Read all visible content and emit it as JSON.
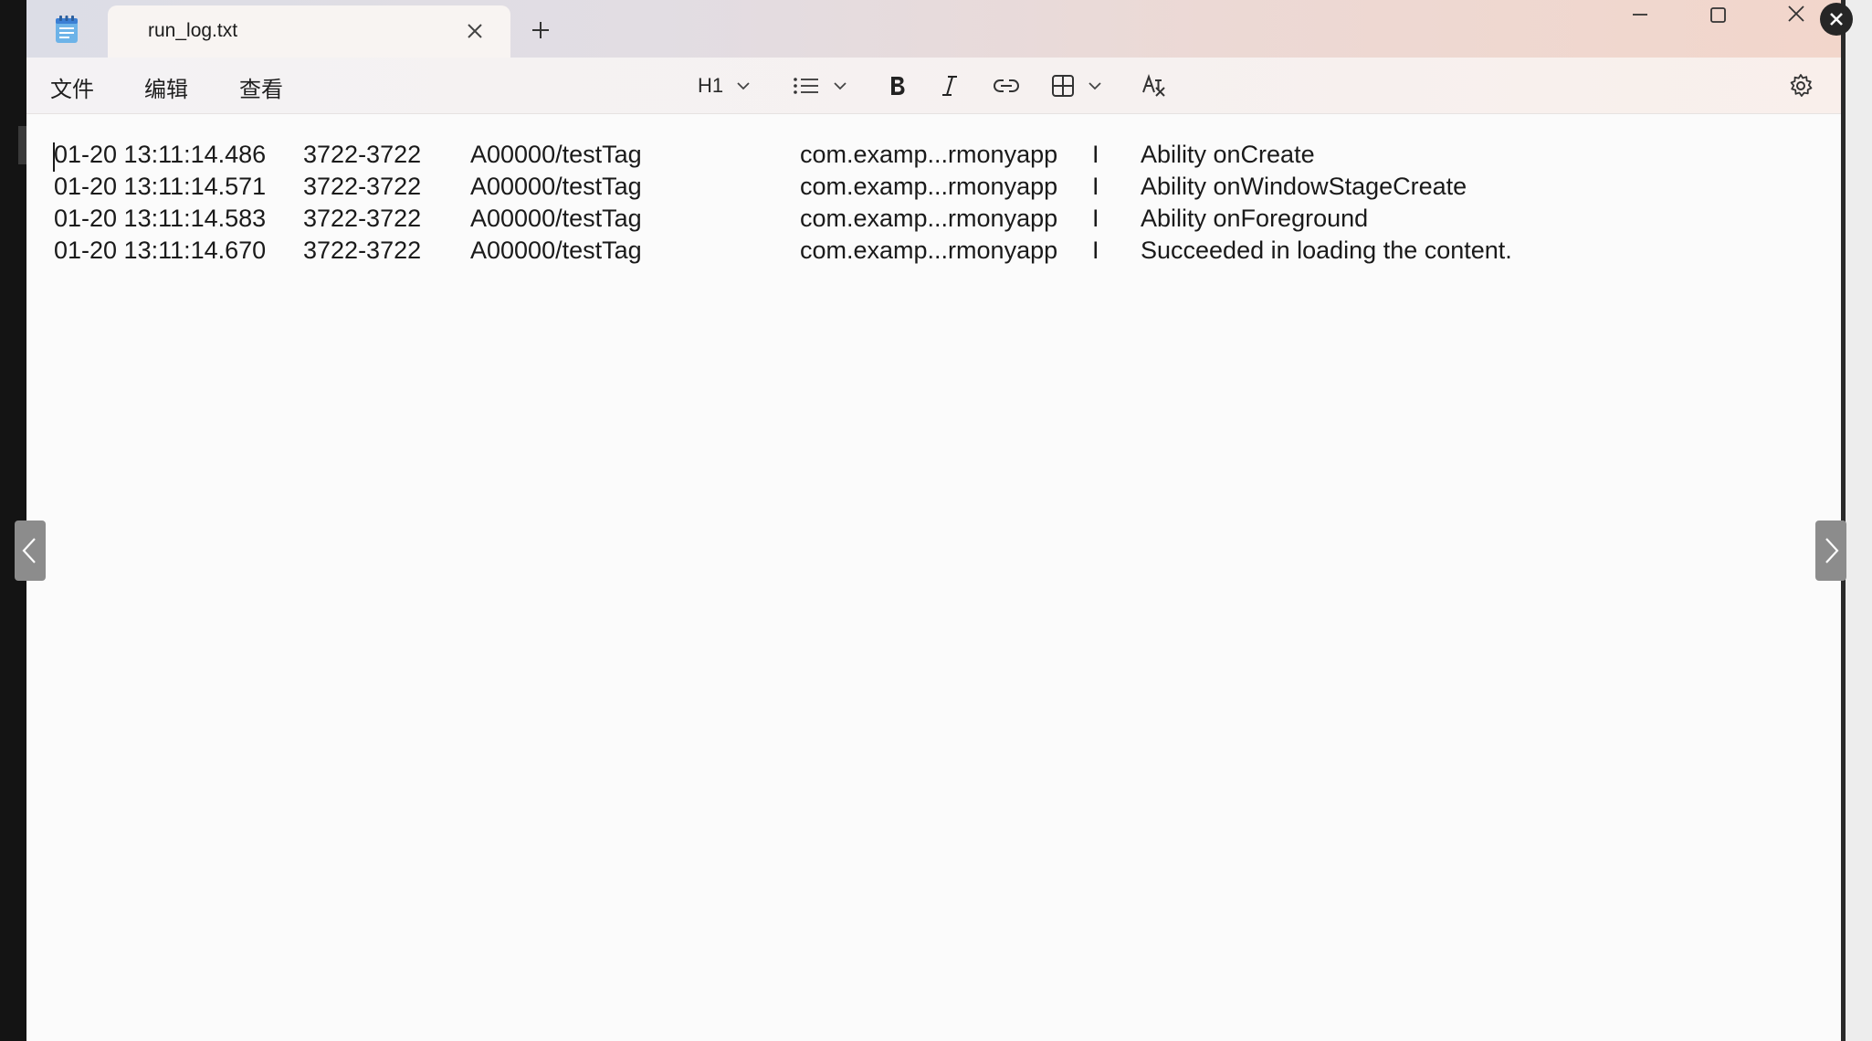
{
  "tab": {
    "title": "run_log.txt"
  },
  "menu": {
    "file": "文件",
    "edit": "编辑",
    "view": "查看"
  },
  "toolbar": {
    "heading_label": "H1"
  },
  "log_lines": [
    {
      "timestamp": "01-20 13:11:14.486",
      "pid": "3722-3722",
      "tag": "A00000/testTag",
      "package": "com.examp...rmonyapp",
      "level": "I",
      "message": "Ability onCreate"
    },
    {
      "timestamp": "01-20 13:11:14.571",
      "pid": "3722-3722",
      "tag": "A00000/testTag",
      "package": "com.examp...rmonyapp",
      "level": "I",
      "message": "Ability onWindowStageCreate"
    },
    {
      "timestamp": "01-20 13:11:14.583",
      "pid": "3722-3722",
      "tag": "A00000/testTag",
      "package": "com.examp...rmonyapp",
      "level": "I",
      "message": "Ability onForeground"
    },
    {
      "timestamp": "01-20 13:11:14.670",
      "pid": "3722-3722",
      "tag": "A00000/testTag",
      "package": "com.examp...rmonyapp",
      "level": "I",
      "message": "Succeeded in loading the content."
    }
  ],
  "icons": {
    "app": "notepad-icon",
    "tab_close": "close-icon",
    "new_tab": "plus-icon",
    "minimize": "minimize-icon",
    "maximize": "maximize-icon",
    "window_close": "close-icon",
    "list": "bulleted-list-icon",
    "bold": "bold-icon",
    "italic": "italic-icon",
    "link": "link-icon",
    "table": "table-icon",
    "clear_format": "clear-formatting-icon",
    "settings": "gear-icon",
    "prev": "chevron-left-icon",
    "next": "chevron-right-icon"
  },
  "colors": {
    "accent": "#3b7fd4",
    "text": "#1a1a1a",
    "editor_bg": "#fbfbfb"
  }
}
